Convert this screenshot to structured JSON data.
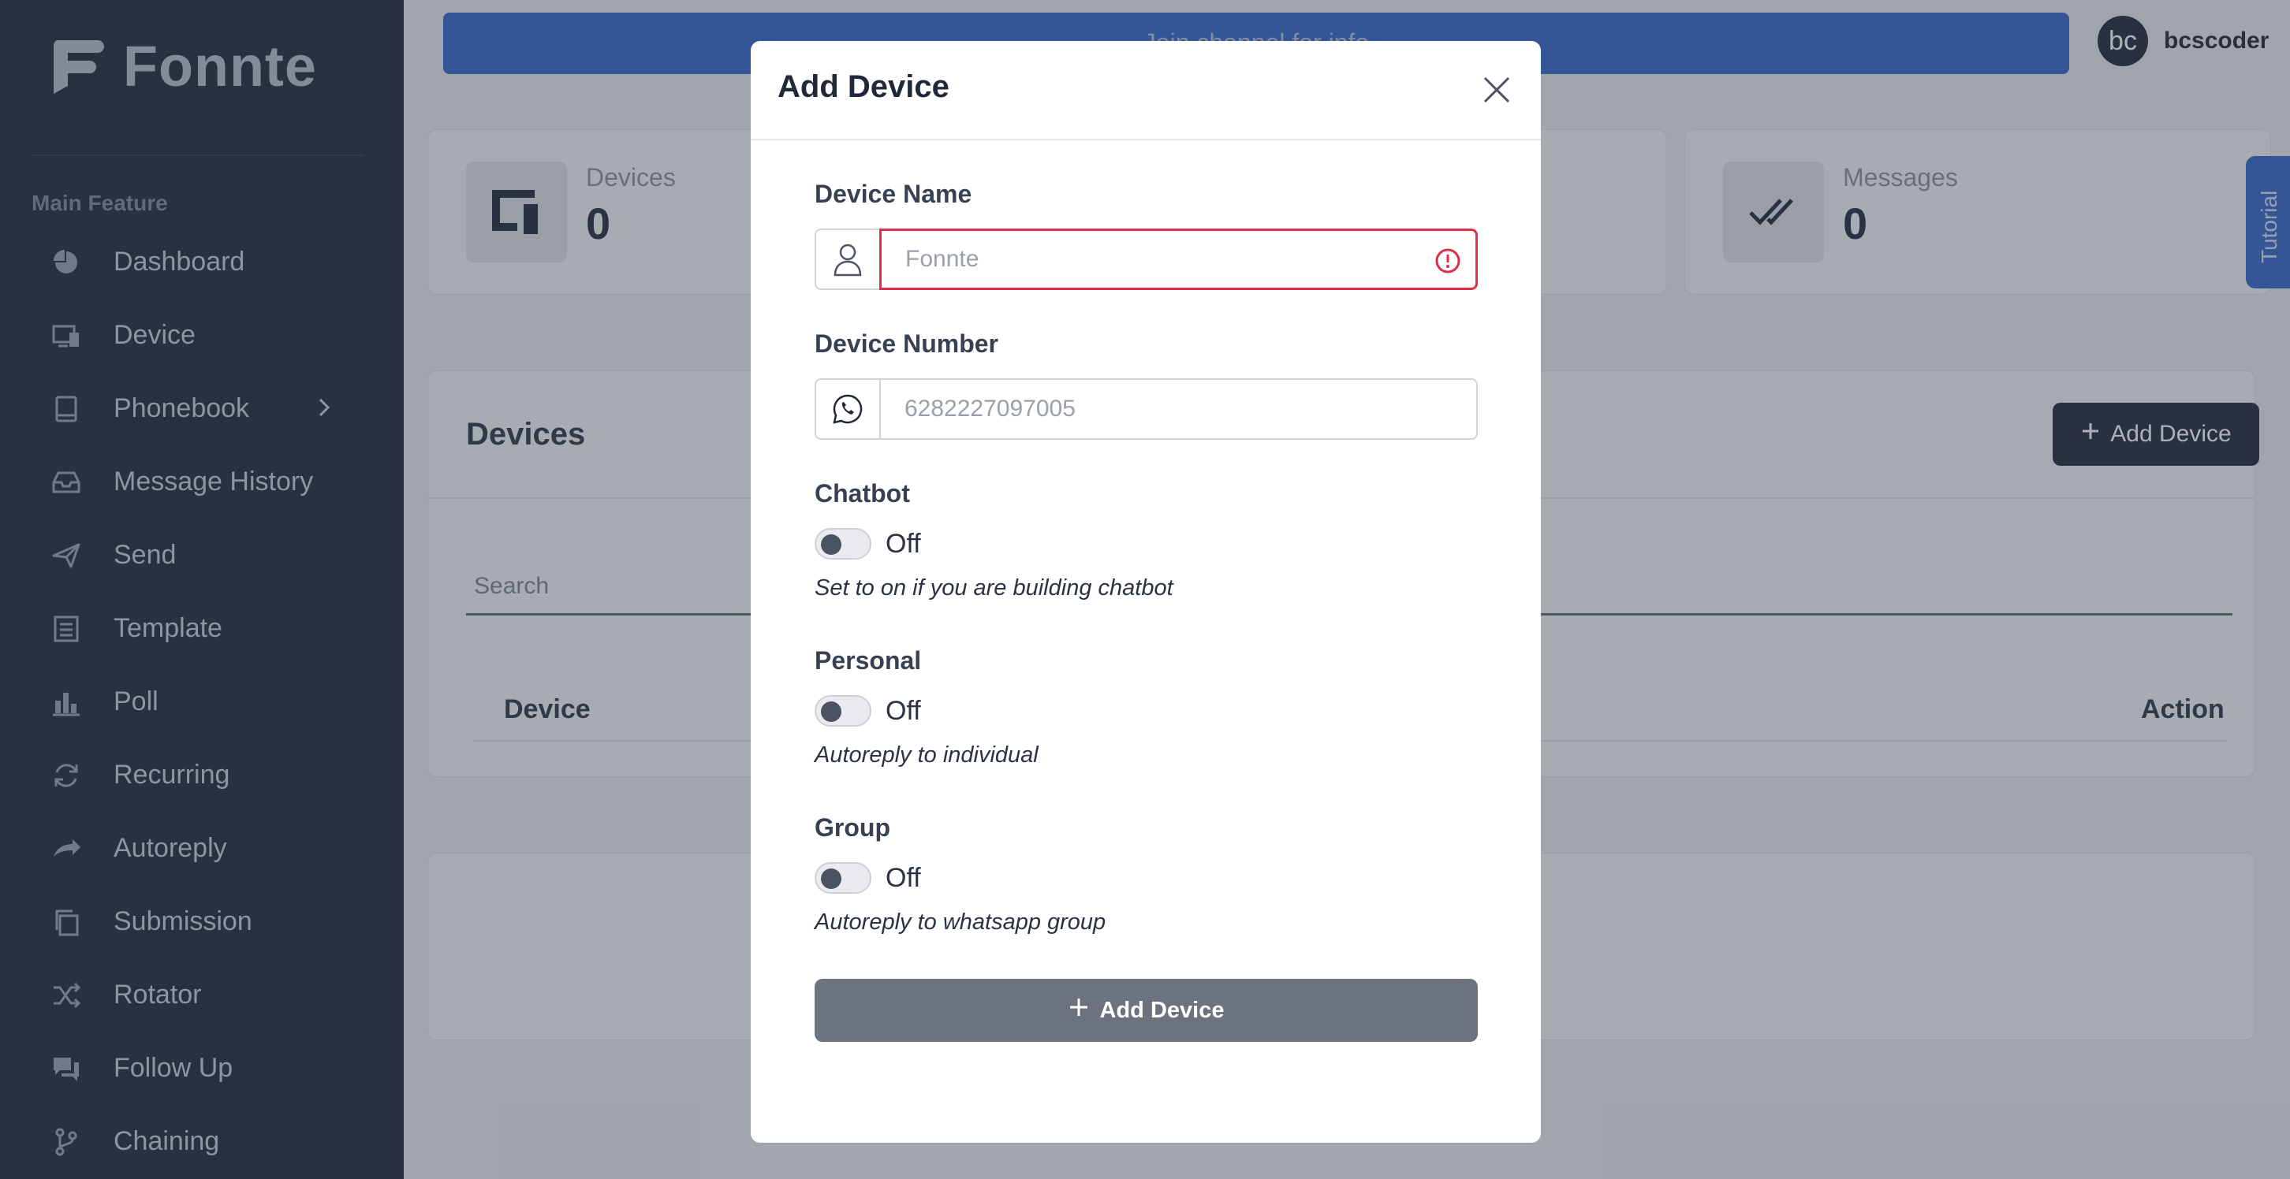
{
  "brand": {
    "name": "Fonnte"
  },
  "sidebar": {
    "section_label": "Main Feature",
    "items": [
      {
        "label": "Dashboard",
        "icon": "pie-chart-icon"
      },
      {
        "label": "Device",
        "icon": "devices-icon"
      },
      {
        "label": "Phonebook",
        "icon": "book-icon",
        "has_submenu": true
      },
      {
        "label": "Message History",
        "icon": "inbox-icon"
      },
      {
        "label": "Send",
        "icon": "send-icon"
      },
      {
        "label": "Template",
        "icon": "template-icon"
      },
      {
        "label": "Poll",
        "icon": "bar-chart-icon"
      },
      {
        "label": "Recurring",
        "icon": "refresh-icon"
      },
      {
        "label": "Autoreply",
        "icon": "reply-icon"
      },
      {
        "label": "Submission",
        "icon": "copy-icon"
      },
      {
        "label": "Rotator",
        "icon": "shuffle-icon"
      },
      {
        "label": "Follow Up",
        "icon": "chat-icon"
      },
      {
        "label": "Chaining",
        "icon": "branch-icon"
      }
    ]
  },
  "header": {
    "banner_text": "Join channel for info",
    "user": {
      "initials": "bc",
      "name": "bcscoder"
    }
  },
  "stats": {
    "devices": {
      "label": "Devices",
      "value": "0"
    },
    "messages": {
      "label": "Messages",
      "value": "0"
    }
  },
  "tutorial_label": "Tutorial",
  "devices_section": {
    "title": "Devices",
    "add_button": "Add Device",
    "search_placeholder": "Search",
    "columns": {
      "device": "Device",
      "action": "Action"
    }
  },
  "modal": {
    "title": "Add Device",
    "device_name": {
      "label": "Device Name",
      "placeholder": "Fonnte"
    },
    "device_number": {
      "label": "Device Number",
      "placeholder": "6282227097005"
    },
    "chatbot": {
      "label": "Chatbot",
      "state": "Off",
      "help": "Set to on if you are building chatbot"
    },
    "personal": {
      "label": "Personal",
      "state": "Off",
      "help": "Autoreply to individual"
    },
    "group": {
      "label": "Group",
      "state": "Off",
      "help": "Autoreply to whatsapp group"
    },
    "submit": "Add Device"
  },
  "colors": {
    "sidebar": "#1c2434",
    "accent": "#2f64c9",
    "error": "#dc2f4a",
    "disabled_button": "#6c737e"
  }
}
